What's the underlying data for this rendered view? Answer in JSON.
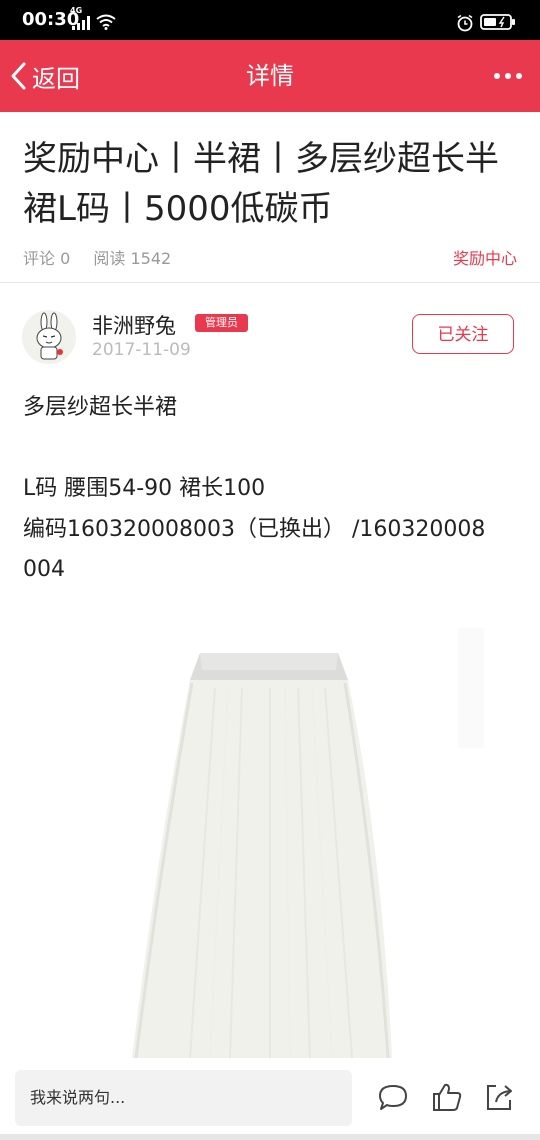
{
  "status_bar": {
    "time": "00:30",
    "network": "4G"
  },
  "header": {
    "back_label": "返回",
    "title": "详情"
  },
  "article": {
    "title": "奖励中心丨半裙丨多层纱超长半裙L码丨5000低碳币",
    "comments": "评论 0",
    "reads": "阅读 1542",
    "category": "奖励中心"
  },
  "author": {
    "name": "非洲野兔",
    "badge": "管理员",
    "date": "2017-11-09",
    "follow_label": "已关注"
  },
  "content": {
    "line1": "多层纱超长半裙",
    "line2": "L码 腰围54-90 裙长100",
    "line3": "编码160320008003（已换出） /160320008",
    "line4": "004"
  },
  "bottom_bar": {
    "comment_placeholder": "我来说两句..."
  },
  "colors": {
    "accent": "#e8394e",
    "text": "#222222",
    "muted": "#999999"
  },
  "icons": [
    "signal-icon",
    "wifi-icon",
    "alarm-icon",
    "battery-icon",
    "back-arrow-icon",
    "more-icon",
    "comment-icon",
    "like-icon",
    "share-icon"
  ]
}
